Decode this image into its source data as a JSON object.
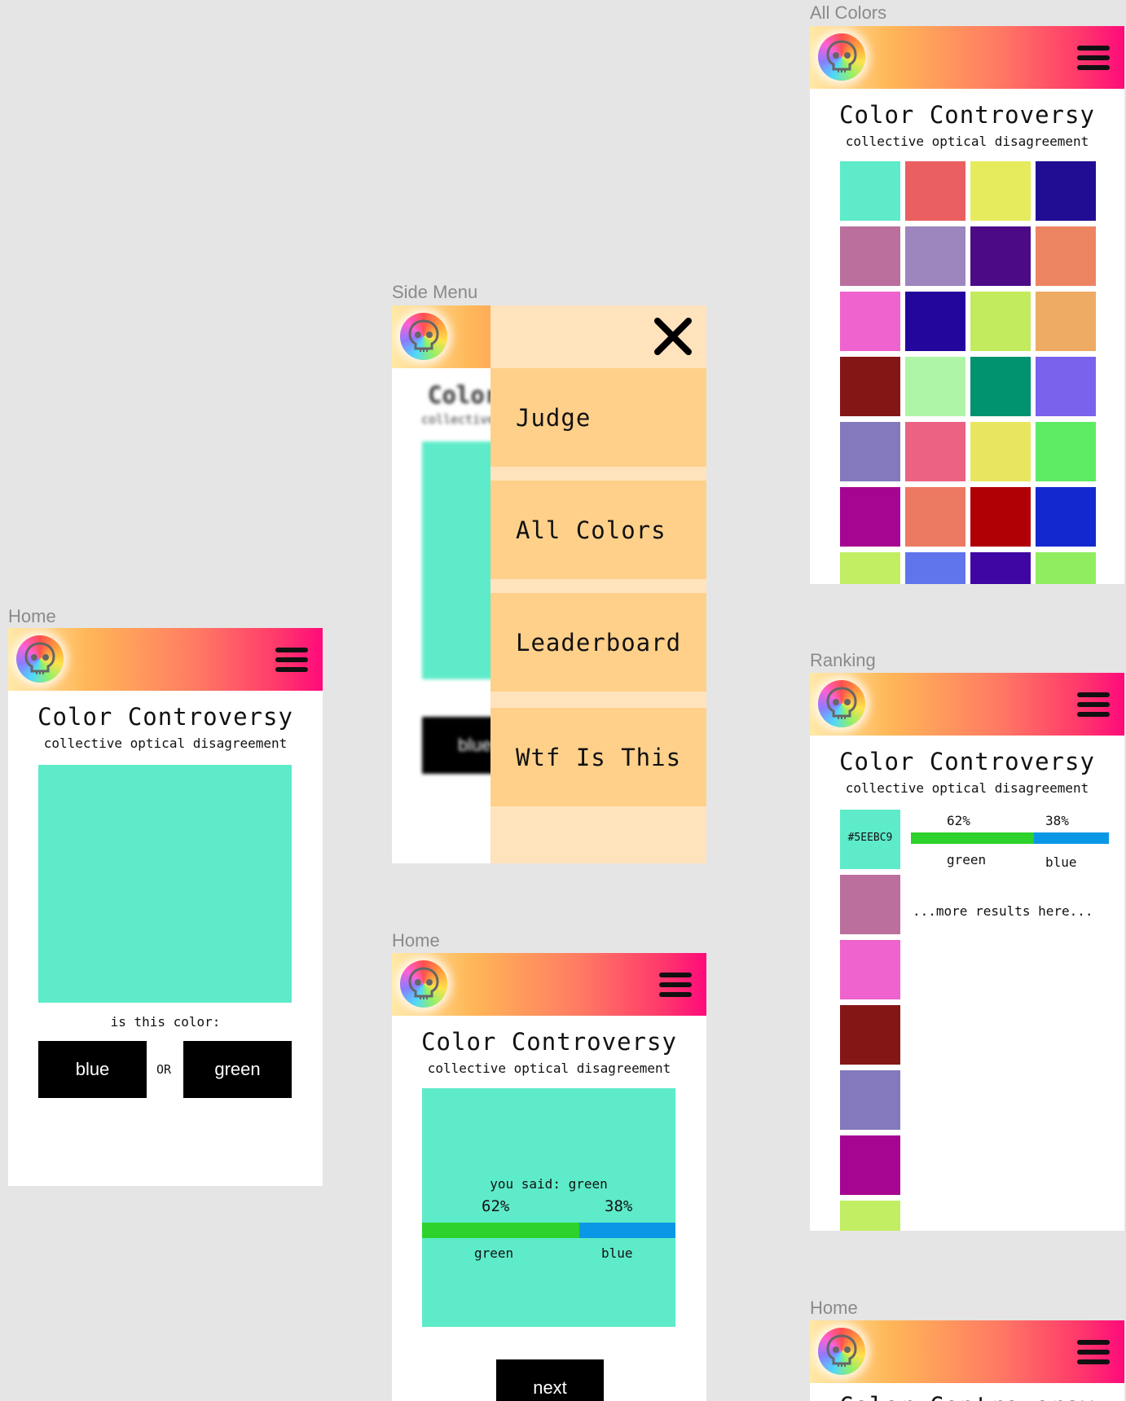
{
  "app": {
    "title": "Color Controversy",
    "subtitle": "collective optical disagreement"
  },
  "labels": {
    "home": "Home",
    "side_menu": "Side Menu",
    "all_colors": "All Colors",
    "ranking": "Ranking",
    "home_result": "Home",
    "home_bottom": "Home"
  },
  "home": {
    "swatch_color": "#5EEBC9",
    "question": "is this color:",
    "option_a": "blue",
    "or": "OR",
    "option_b": "green"
  },
  "side_menu": {
    "items": [
      "Judge",
      "All Colors",
      "Leaderboard",
      "Wtf Is This"
    ],
    "blurred_title": "Color",
    "blurred_subtitle": "collective",
    "blurred_button": "blue"
  },
  "result": {
    "you_said": "you said: green",
    "green_pct": "62%",
    "blue_pct": "38%",
    "green_share": 0.62,
    "green_label": "green",
    "blue_label": "blue",
    "next": "next"
  },
  "all_colors": {
    "swatches": [
      "#5EEBC9",
      "#EA6060",
      "#E6EB5E",
      "#200D94",
      "#BA6F9D",
      "#9D86BD",
      "#4D0A87",
      "#EC8462",
      "#EE63CD",
      "#23079C",
      "#C2EB5E",
      "#EDAB63",
      "#851616",
      "#AEF5A7",
      "#019370",
      "#7A62EC",
      "#8479BC",
      "#EC6283",
      "#E8E65F",
      "#5EEB64",
      "#A60591",
      "#EC7A62",
      "#B00006",
      "#1428CF",
      "#C1EE62",
      "#6075EC",
      "#3F06A4",
      "#91ED60"
    ]
  },
  "ranking": {
    "first_hex": "#5EEBC9",
    "green_pct": "62%",
    "blue_pct": "38%",
    "green_share": 0.62,
    "green_label": "green",
    "blue_label": "blue",
    "more": "...more results here...",
    "list": [
      "#5EEBC9",
      "#BA6F9D",
      "#EE63CD",
      "#851616",
      "#8479BC",
      "#A60591",
      "#C1EE62"
    ]
  },
  "colors": {
    "teal": "#5EEBC9",
    "menu_bg": "#FFE3BD",
    "menu_item": "#FFD08A",
    "bar_green": "#2ED22C",
    "bar_blue": "#0A98E6"
  },
  "icons": {
    "logo": "skull-color-wheel-icon",
    "menu": "hamburger-icon",
    "close": "close-x-icon"
  }
}
